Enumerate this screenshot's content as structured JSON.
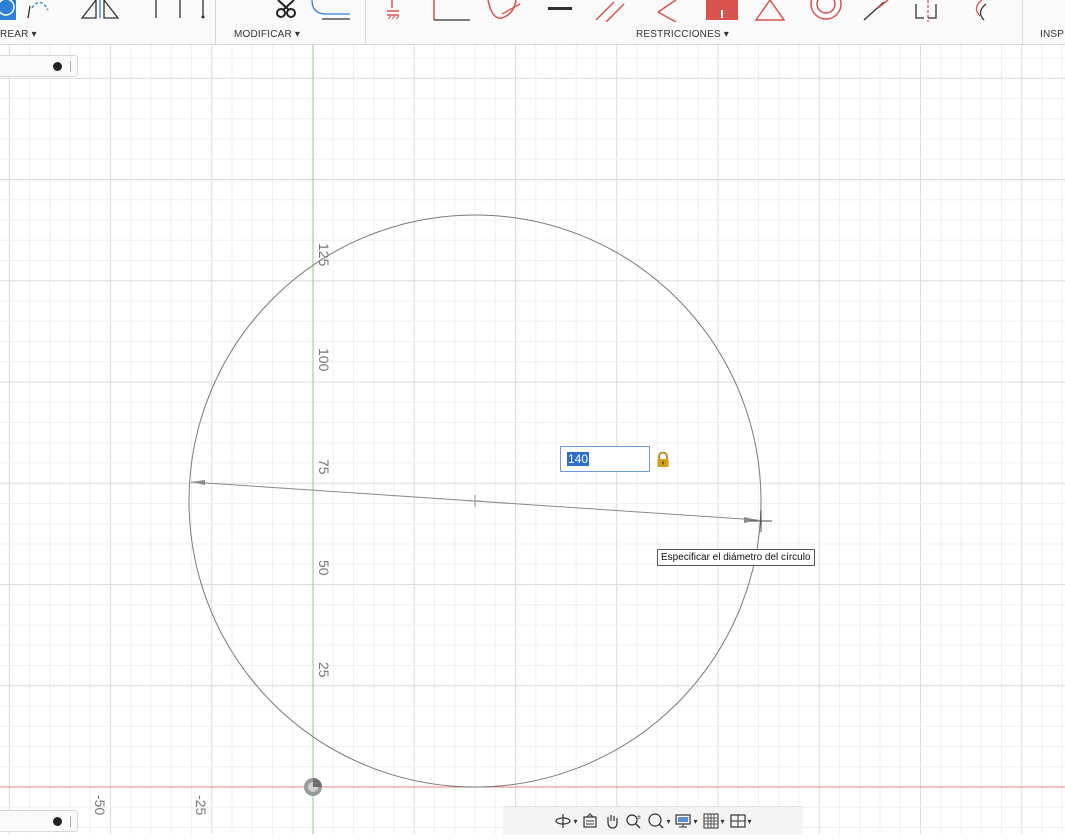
{
  "toolbar": {
    "sections": [
      {
        "id": "crear",
        "label": "REAR ▾"
      },
      {
        "id": "modificar",
        "label": "MODIFICAR ▾"
      },
      {
        "id": "restricciones",
        "label": "RESTRICCIONES ▾"
      },
      {
        "id": "inspeccionar",
        "label": "INSP"
      }
    ],
    "colors": {
      "accent_blue": "#2f7fd6",
      "constraint_red": "#d9534f",
      "lock_gold": "#d4a017"
    }
  },
  "sketch": {
    "axis_labels_vertical": [
      "125",
      "100",
      "75",
      "50",
      "25"
    ],
    "axis_labels_horizontal": [
      "-50",
      "-25"
    ],
    "axis_colors": {
      "vertical": "#7fd67f",
      "horizontal": "#f08080"
    },
    "circle_color": "#7a7a7a"
  },
  "dimension_input": {
    "value": "140",
    "lock_icon": "lock-icon"
  },
  "tooltip": {
    "text": "Especificar el diámetro del círculo"
  },
  "navigation_bar": {
    "icons": [
      "orbit-icon",
      "look-at-icon",
      "pan-icon",
      "zoom-icon",
      "zoom-window-icon",
      "display-settings-icon",
      "grid-icon",
      "viewports-icon"
    ]
  }
}
